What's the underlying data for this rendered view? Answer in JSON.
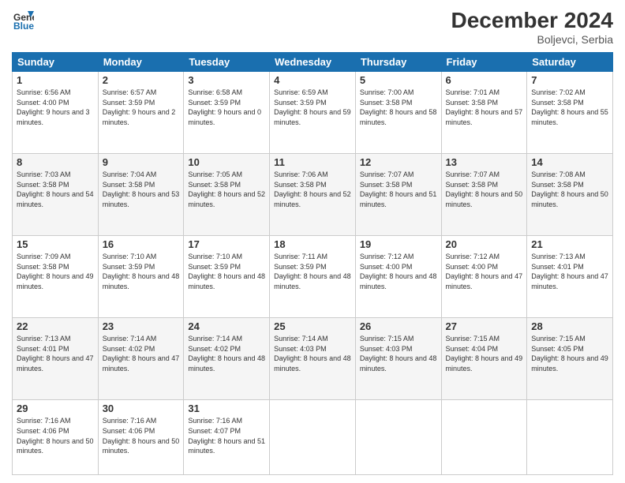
{
  "header": {
    "logo_line1": "General",
    "logo_line2": "Blue",
    "month": "December 2024",
    "location": "Boljevci, Serbia"
  },
  "weekdays": [
    "Sunday",
    "Monday",
    "Tuesday",
    "Wednesday",
    "Thursday",
    "Friday",
    "Saturday"
  ],
  "weeks": [
    [
      {
        "day": "1",
        "sunrise": "Sunrise: 6:56 AM",
        "sunset": "Sunset: 4:00 PM",
        "daylight": "Daylight: 9 hours and 3 minutes."
      },
      {
        "day": "2",
        "sunrise": "Sunrise: 6:57 AM",
        "sunset": "Sunset: 3:59 PM",
        "daylight": "Daylight: 9 hours and 2 minutes."
      },
      {
        "day": "3",
        "sunrise": "Sunrise: 6:58 AM",
        "sunset": "Sunset: 3:59 PM",
        "daylight": "Daylight: 9 hours and 0 minutes."
      },
      {
        "day": "4",
        "sunrise": "Sunrise: 6:59 AM",
        "sunset": "Sunset: 3:59 PM",
        "daylight": "Daylight: 8 hours and 59 minutes."
      },
      {
        "day": "5",
        "sunrise": "Sunrise: 7:00 AM",
        "sunset": "Sunset: 3:58 PM",
        "daylight": "Daylight: 8 hours and 58 minutes."
      },
      {
        "day": "6",
        "sunrise": "Sunrise: 7:01 AM",
        "sunset": "Sunset: 3:58 PM",
        "daylight": "Daylight: 8 hours and 57 minutes."
      },
      {
        "day": "7",
        "sunrise": "Sunrise: 7:02 AM",
        "sunset": "Sunset: 3:58 PM",
        "daylight": "Daylight: 8 hours and 55 minutes."
      }
    ],
    [
      {
        "day": "8",
        "sunrise": "Sunrise: 7:03 AM",
        "sunset": "Sunset: 3:58 PM",
        "daylight": "Daylight: 8 hours and 54 minutes."
      },
      {
        "day": "9",
        "sunrise": "Sunrise: 7:04 AM",
        "sunset": "Sunset: 3:58 PM",
        "daylight": "Daylight: 8 hours and 53 minutes."
      },
      {
        "day": "10",
        "sunrise": "Sunrise: 7:05 AM",
        "sunset": "Sunset: 3:58 PM",
        "daylight": "Daylight: 8 hours and 52 minutes."
      },
      {
        "day": "11",
        "sunrise": "Sunrise: 7:06 AM",
        "sunset": "Sunset: 3:58 PM",
        "daylight": "Daylight: 8 hours and 52 minutes."
      },
      {
        "day": "12",
        "sunrise": "Sunrise: 7:07 AM",
        "sunset": "Sunset: 3:58 PM",
        "daylight": "Daylight: 8 hours and 51 minutes."
      },
      {
        "day": "13",
        "sunrise": "Sunrise: 7:07 AM",
        "sunset": "Sunset: 3:58 PM",
        "daylight": "Daylight: 8 hours and 50 minutes."
      },
      {
        "day": "14",
        "sunrise": "Sunrise: 7:08 AM",
        "sunset": "Sunset: 3:58 PM",
        "daylight": "Daylight: 8 hours and 50 minutes."
      }
    ],
    [
      {
        "day": "15",
        "sunrise": "Sunrise: 7:09 AM",
        "sunset": "Sunset: 3:58 PM",
        "daylight": "Daylight: 8 hours and 49 minutes."
      },
      {
        "day": "16",
        "sunrise": "Sunrise: 7:10 AM",
        "sunset": "Sunset: 3:59 PM",
        "daylight": "Daylight: 8 hours and 48 minutes."
      },
      {
        "day": "17",
        "sunrise": "Sunrise: 7:10 AM",
        "sunset": "Sunset: 3:59 PM",
        "daylight": "Daylight: 8 hours and 48 minutes."
      },
      {
        "day": "18",
        "sunrise": "Sunrise: 7:11 AM",
        "sunset": "Sunset: 3:59 PM",
        "daylight": "Daylight: 8 hours and 48 minutes."
      },
      {
        "day": "19",
        "sunrise": "Sunrise: 7:12 AM",
        "sunset": "Sunset: 4:00 PM",
        "daylight": "Daylight: 8 hours and 48 minutes."
      },
      {
        "day": "20",
        "sunrise": "Sunrise: 7:12 AM",
        "sunset": "Sunset: 4:00 PM",
        "daylight": "Daylight: 8 hours and 47 minutes."
      },
      {
        "day": "21",
        "sunrise": "Sunrise: 7:13 AM",
        "sunset": "Sunset: 4:01 PM",
        "daylight": "Daylight: 8 hours and 47 minutes."
      }
    ],
    [
      {
        "day": "22",
        "sunrise": "Sunrise: 7:13 AM",
        "sunset": "Sunset: 4:01 PM",
        "daylight": "Daylight: 8 hours and 47 minutes."
      },
      {
        "day": "23",
        "sunrise": "Sunrise: 7:14 AM",
        "sunset": "Sunset: 4:02 PM",
        "daylight": "Daylight: 8 hours and 47 minutes."
      },
      {
        "day": "24",
        "sunrise": "Sunrise: 7:14 AM",
        "sunset": "Sunset: 4:02 PM",
        "daylight": "Daylight: 8 hours and 48 minutes."
      },
      {
        "day": "25",
        "sunrise": "Sunrise: 7:14 AM",
        "sunset": "Sunset: 4:03 PM",
        "daylight": "Daylight: 8 hours and 48 minutes."
      },
      {
        "day": "26",
        "sunrise": "Sunrise: 7:15 AM",
        "sunset": "Sunset: 4:03 PM",
        "daylight": "Daylight: 8 hours and 48 minutes."
      },
      {
        "day": "27",
        "sunrise": "Sunrise: 7:15 AM",
        "sunset": "Sunset: 4:04 PM",
        "daylight": "Daylight: 8 hours and 49 minutes."
      },
      {
        "day": "28",
        "sunrise": "Sunrise: 7:15 AM",
        "sunset": "Sunset: 4:05 PM",
        "daylight": "Daylight: 8 hours and 49 minutes."
      }
    ],
    [
      {
        "day": "29",
        "sunrise": "Sunrise: 7:16 AM",
        "sunset": "Sunset: 4:06 PM",
        "daylight": "Daylight: 8 hours and 50 minutes."
      },
      {
        "day": "30",
        "sunrise": "Sunrise: 7:16 AM",
        "sunset": "Sunset: 4:06 PM",
        "daylight": "Daylight: 8 hours and 50 minutes."
      },
      {
        "day": "31",
        "sunrise": "Sunrise: 7:16 AM",
        "sunset": "Sunset: 4:07 PM",
        "daylight": "Daylight: 8 hours and 51 minutes."
      },
      null,
      null,
      null,
      null
    ]
  ]
}
